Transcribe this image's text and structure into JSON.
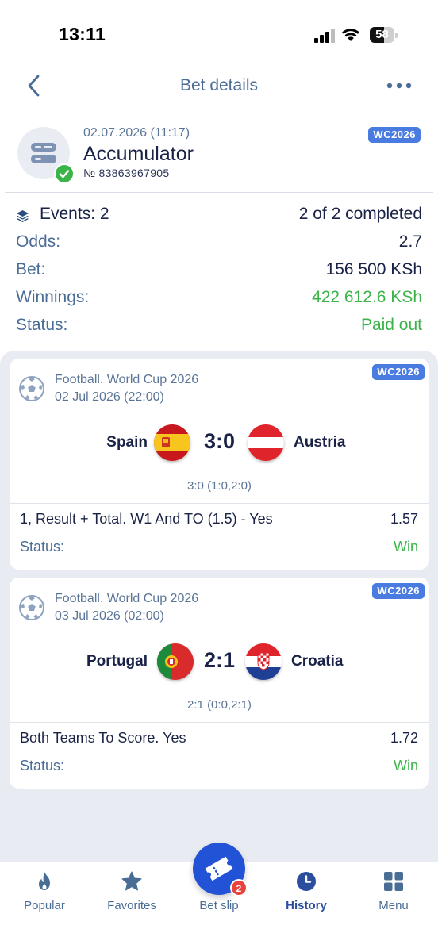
{
  "status_bar": {
    "time": "13:11",
    "battery": "58",
    "battery_level": 0.58
  },
  "nav": {
    "title": "Bet details"
  },
  "bet": {
    "date": "02.07.2026 (11:17)",
    "type": "Accumulator",
    "number": "№ 83863967905",
    "tag": "WC2026"
  },
  "summary": {
    "events_label": "Events: 2",
    "events_value": "2 of 2 completed",
    "odds_label": "Odds:",
    "odds_value": "2.7",
    "bet_label": "Bet:",
    "bet_value": "156 500 KSh",
    "winnings_label": "Winnings:",
    "winnings_value": "422 612.6 KSh",
    "status_label": "Status:",
    "status_value": "Paid out"
  },
  "events": [
    {
      "tag": "WC2026",
      "league": "Football. World Cup 2026",
      "date": "02 Jul 2026 (22:00)",
      "home": "Spain",
      "away": "Austria",
      "score": "3:0",
      "halves": "3:0 (1:0,2:0)",
      "market": "1, Result + Total. W1 And TO (1.5) - Yes",
      "odds": "1.57",
      "status_label": "Status:",
      "status_value": "Win"
    },
    {
      "tag": "WC2026",
      "league": "Football. World Cup 2026",
      "date": "03 Jul 2026 (02:00)",
      "home": "Portugal",
      "away": "Croatia",
      "score": "2:1",
      "halves": "2:1 (0:0,2:1)",
      "market": "Both Teams To Score. Yes",
      "odds": "1.72",
      "status_label": "Status:",
      "status_value": "Win"
    }
  ],
  "tabbar": {
    "items": [
      {
        "label": "Popular",
        "icon": "flame-icon"
      },
      {
        "label": "Favorites",
        "icon": "star-icon"
      },
      {
        "label": "Bet slip",
        "icon": "ticket-icon",
        "badge": "2"
      },
      {
        "label": "History",
        "icon": "clock-icon",
        "active": true
      },
      {
        "label": "Menu",
        "icon": "grid-icon"
      }
    ]
  },
  "colors": {
    "accent": "#2253d6",
    "win": "#3bb44a",
    "label": "#4a6d96",
    "tag": "#4a7be0"
  }
}
